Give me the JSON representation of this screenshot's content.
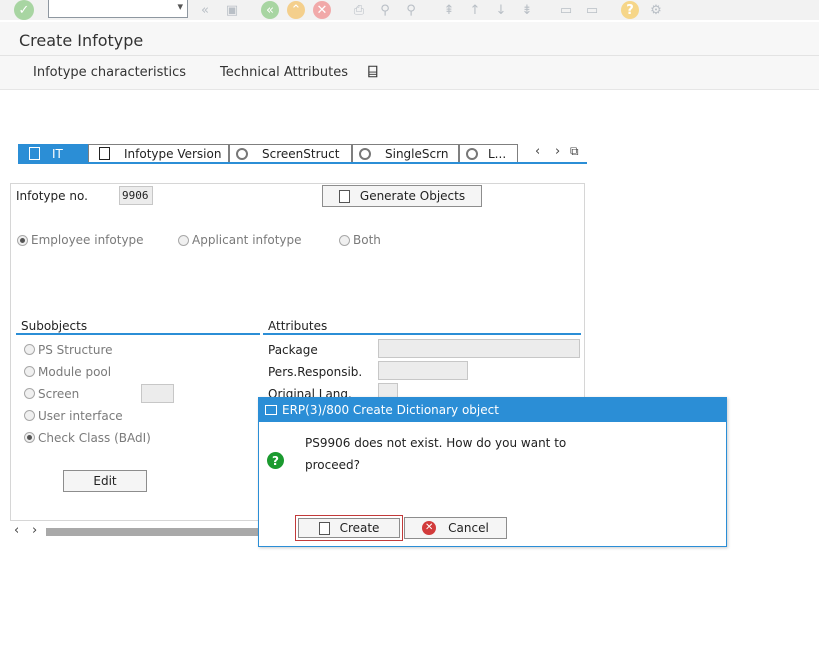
{
  "toolbar": {
    "command_field_value": "",
    "icons": [
      "enter-icon",
      "back-double-icon",
      "save-icon",
      "back-icon",
      "exit-icon",
      "cancel-icon",
      "print-icon",
      "find-icon",
      "find-next-icon",
      "first-page-icon",
      "previous-page-icon",
      "next-page-icon",
      "last-page-icon",
      "new-session-icon",
      "shortcut-icon",
      "help-icon",
      "settings-icon"
    ]
  },
  "header": {
    "title": "Create Infotype"
  },
  "app_toolbar": {
    "btn_characteristics": "Infotype characteristics",
    "btn_technical": "Technical Attributes",
    "more_icon": "⌸"
  },
  "tabs": [
    {
      "label": "IT",
      "active": true
    },
    {
      "label": "Infotype Version"
    },
    {
      "label": "ScreenStruct"
    },
    {
      "label": "SingleScrn"
    },
    {
      "label": "L..."
    }
  ],
  "form": {
    "infotype_no_label": "Infotype no.",
    "infotype_no_value": "9906",
    "generate_objects": "Generate Objects",
    "radio_employee": "Employee infotype",
    "radio_applicant": "Applicant infotype",
    "radio_both": "Both",
    "subobjects_title": "Subobjects",
    "sub_ps_structure": "PS Structure",
    "sub_module_pool": "Module pool",
    "sub_screen": "Screen",
    "sub_user_interface": "User interface",
    "sub_check_class": "Check Class (BAdI)",
    "edit": "Edit",
    "attributes_title": "Attributes",
    "attr_package": "Package",
    "attr_pers_resp": "Pers.Responsib.",
    "attr_orig_lang": "Original Lang."
  },
  "dialog": {
    "title": "ERP(3)/800 Create Dictionary object",
    "message_line1": "PS9906 does not exist. How do you want to",
    "message_line2": "proceed?",
    "create": "Create",
    "cancel": "Cancel"
  },
  "colors": {
    "accent": "#2b8ed6",
    "success": "#1b9a2f",
    "danger": "#d23b3b"
  }
}
